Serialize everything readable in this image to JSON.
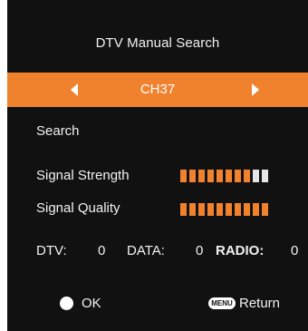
{
  "title": "DTV Manual Search",
  "channel": {
    "value": "CH37",
    "left_icon": "triangle-left-icon",
    "right_icon": "triangle-right-icon",
    "highlight_color": "#f0822d"
  },
  "search_label": "Search",
  "signal_strength": {
    "label": "Signal Strength",
    "segments_total": 10,
    "segments_filled": 8
  },
  "signal_quality": {
    "label": "Signal Quality",
    "segments_total": 10,
    "segments_filled": 10
  },
  "counts": {
    "dtv_label": "DTV:",
    "dtv_value": "0",
    "data_label": "DATA:",
    "data_value": "0",
    "radio_label": "RADIO:",
    "radio_value": "0"
  },
  "footer": {
    "ok_icon": "circle-ok-icon",
    "ok_label": "OK",
    "menu_key": "MENU",
    "return_label": "Return"
  }
}
